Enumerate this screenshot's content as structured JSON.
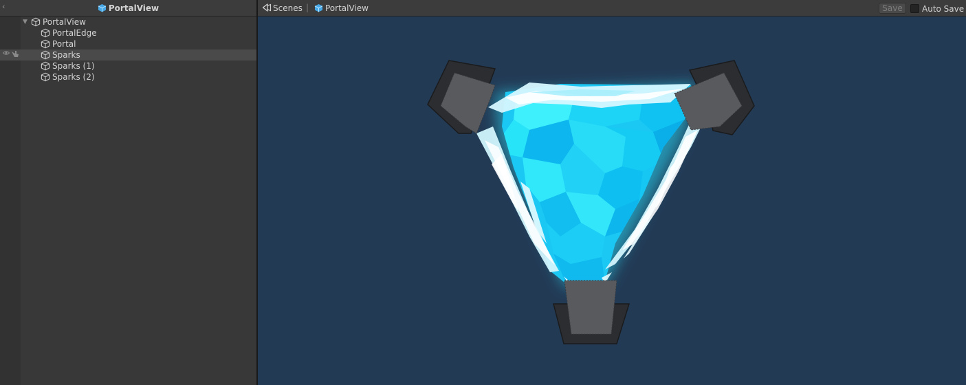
{
  "hierarchy": {
    "title": "PortalView",
    "root": "PortalView",
    "children": [
      "PortalEdge",
      "Portal",
      "Sparks",
      "Sparks (1)",
      "Sparks (2)"
    ],
    "selected": "Sparks"
  },
  "scene": {
    "breadcrumb_scenes": "Scenes",
    "breadcrumb_prefab": "PortalView",
    "breadcrumb_separator": "|",
    "save_label": "Save",
    "autosave_label": "Auto Save",
    "autosave_checked": false
  },
  "colors": {
    "scene_background": "#233a55",
    "crystal_cyan": "#19d0f5",
    "editor_panel": "#383838",
    "gray_block": "#585a5e"
  },
  "icons": {
    "collapse": "chevron-left-icon",
    "prefab": "prefab-cube-icon",
    "gameobject": "cube-icon",
    "scenes": "scenes-icon",
    "visibility": "eye-icon",
    "pickable": "hand-icon"
  }
}
